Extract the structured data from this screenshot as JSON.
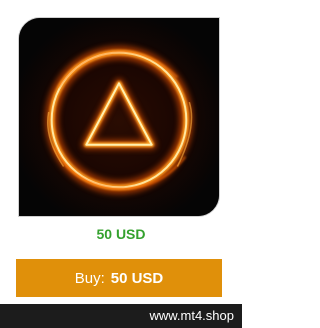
{
  "product": {
    "image_icon": "fire-ring-triangle-logo",
    "price": "50 USD"
  },
  "buy_button": {
    "label": "Buy:",
    "amount": "50 USD"
  },
  "footer": {
    "site": "www.mt4.shop"
  },
  "colors": {
    "price": "#34a12e",
    "button": "#e0900a",
    "footer": "#1c1c1c",
    "image_bg": "#0a0a0a"
  }
}
